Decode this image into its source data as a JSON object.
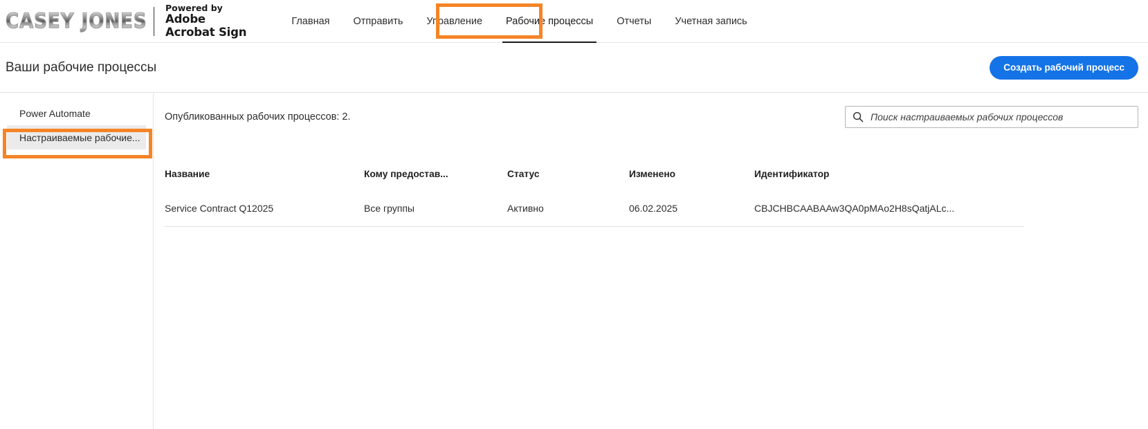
{
  "brand": {
    "company_logo_text": "CASEY JONES",
    "powered_by": "Powered by",
    "product_line1": "Adobe",
    "product_line2": "Acrobat Sign"
  },
  "nav": {
    "items": [
      {
        "label": "Главная",
        "active": false
      },
      {
        "label": "Отправить",
        "active": false
      },
      {
        "label": "Управление",
        "active": false
      },
      {
        "label": "Рабочие процессы",
        "active": true
      },
      {
        "label": "Отчеты",
        "active": false
      },
      {
        "label": "Учетная запись",
        "active": false
      }
    ]
  },
  "header": {
    "page_title": "Ваши рабочие процессы",
    "create_button": "Создать рабочий процесс",
    "accent_color": "#1473e6",
    "highlight_color": "#f58426"
  },
  "sidebar": {
    "items": [
      {
        "label": "Power Automate",
        "selected": false
      },
      {
        "label": "Настраиваемые рабочие...",
        "selected": true
      }
    ]
  },
  "main": {
    "count_text": "Опубликованных рабочих процессов: 2.",
    "search": {
      "placeholder": "Поиск настраиваемых рабочих процессов",
      "value": "",
      "icon": "search-icon"
    },
    "table": {
      "columns": [
        "Название",
        "Кому предостав...",
        "Статус",
        "Изменено",
        "Идентификатор"
      ],
      "rows": [
        {
          "name": "Service Contract Q12025",
          "shared_with": "Все группы",
          "status": "Активно",
          "modified": "06.02.2025",
          "identifier": "CBJCHBCAABAAw3QA0pMAo2H8sQatjALc..."
        }
      ]
    }
  }
}
